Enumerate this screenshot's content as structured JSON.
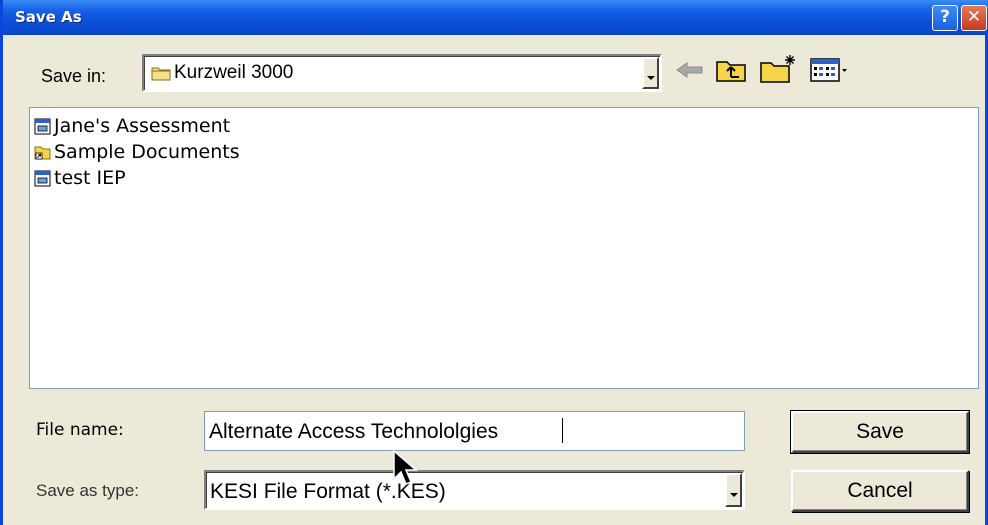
{
  "window": {
    "title": "Save As",
    "help_glyph": "?",
    "close_glyph": "✕"
  },
  "toolbar": {
    "save_in_label": "Save in:",
    "save_in_value": "Kurzweil 3000",
    "icons": [
      "back-arrow-icon",
      "up-one-level-icon",
      "new-folder-icon",
      "views-menu-icon"
    ]
  },
  "files": [
    {
      "name": "Jane's Assessment",
      "icon": "kes-document-icon"
    },
    {
      "name": "Sample Documents",
      "icon": "folder-shortcut-icon"
    },
    {
      "name": "test IEP",
      "icon": "kes-document-icon"
    }
  ],
  "form": {
    "file_name_label": "File name:",
    "file_name_value": "Alternate Access Technololgies",
    "save_as_type_label": "Save as type:",
    "save_as_type_value": "KESI File Format (*.KES)"
  },
  "buttons": {
    "save": "Save",
    "cancel": "Cancel"
  },
  "colors": {
    "title_bar": "#0a4fd6",
    "dialog_face": "#ece9d8",
    "close_button": "#c8381c"
  }
}
